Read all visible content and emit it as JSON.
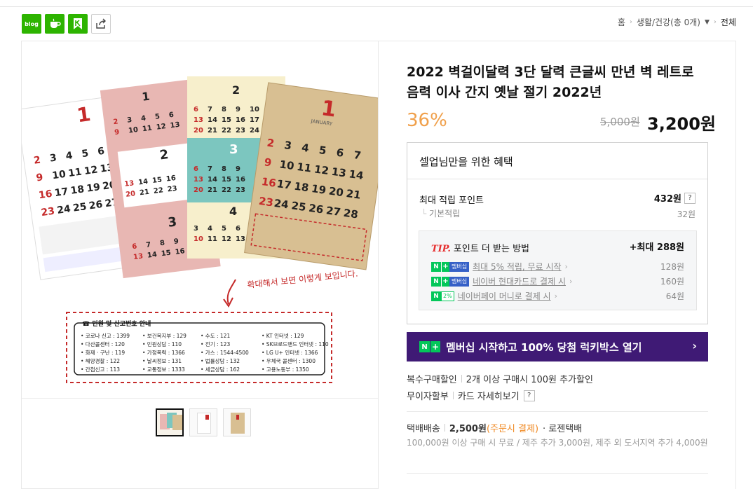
{
  "share": {
    "blog_label": "blog"
  },
  "breadcrumb": {
    "home": "홈",
    "category": "생활/건강(총 0개)",
    "current": "전체"
  },
  "product": {
    "title": "2022 벽걸이달력 3단 달력 큰글씨 만년 벽 레트로 음력 이사 간지 옛날 절기 2022년",
    "discount": "36%",
    "original_price": "5,000원",
    "sale_price": "3,200원"
  },
  "benefits": {
    "header": "셀업님만을 위한 혜택",
    "max_points_label": "최대 적립 포인트",
    "max_points_value": "432원",
    "help_label": "?",
    "basic_label": "기본적립",
    "basic_value": "32원",
    "tip": {
      "tag": "TIP.",
      "title": "포인트 더 받는 방법",
      "max_label": "+최대 288원",
      "items": [
        {
          "badge_n": "N",
          "badge_p": "+",
          "badge": "멤버십",
          "text": "최대 5% 적립, 무료 시작",
          "value": "128원"
        },
        {
          "badge_n": "N",
          "badge_p": "+",
          "badge": "멤버십",
          "text": "네이버 현대카드로 결제 시",
          "value": "160원"
        },
        {
          "badge_n": "N",
          "badge_p": "2%",
          "badge": "",
          "text": "네이버페이 머니로 결제 시",
          "value": "64원"
        }
      ]
    }
  },
  "banner": {
    "n": "N",
    "plus": "+",
    "text": "멤버십 시작하고 100% 당첨 럭키박스 열기",
    "arrow": "›"
  },
  "multi_buy": {
    "label": "복수구매할인",
    "value": "2개 이상 구매시 100원 추가할인"
  },
  "installment": {
    "label": "무이자할부",
    "link": "카드 자세히보기",
    "help": "?"
  },
  "shipping": {
    "label": "택배배송",
    "fee": "2,500원",
    "fee_note": "(주문시 결제)",
    "carrier": "· 로젠택배",
    "note": "100,000원 이상 구매 시 무료 / 제주 추가 3,000원, 제주 외 도서지역 추가 4,000원"
  },
  "image": {
    "calendar_month": "1",
    "month2": "2",
    "month3": "3",
    "month_en": "JANUARY",
    "annotation": "확대해서 보면 이렇게 보입니다.",
    "info_box_title": "민원 및 신고번호 안내",
    "info_rows": [
      [
        "• 코로나 신고 : 1399",
        "• 보건복지부 : 129",
        "• 수도 : 121",
        "• KT 인터넷 : 129"
      ],
      [
        "• 다산콜센터 : 120",
        "• 민원상담 : 110",
        "• 전기 : 123",
        "• SK브로드밴드 인터넷 : 110"
      ],
      [
        "• 화재 · 구난 : 119",
        "• 가정폭력 : 1366",
        "• 가스 : 1544-4500",
        "• LG U+ 인터넷 : 1366"
      ],
      [
        "• 해양경찰 : 122",
        "• 날씨정보 : 131",
        "• 법률상담 : 132",
        "• 우체국 콜센터 : 1300"
      ],
      [
        "• 간첩신고 : 113",
        "• 교통정보 : 1333",
        "• 세금상담 : 162",
        "• 고용노동부 : 1350"
      ]
    ]
  },
  "colors": {
    "accent": "#f0a04b",
    "naver_green": "#03c75a",
    "banner": "#3f1a75",
    "tip_red": "#e62e2e"
  }
}
